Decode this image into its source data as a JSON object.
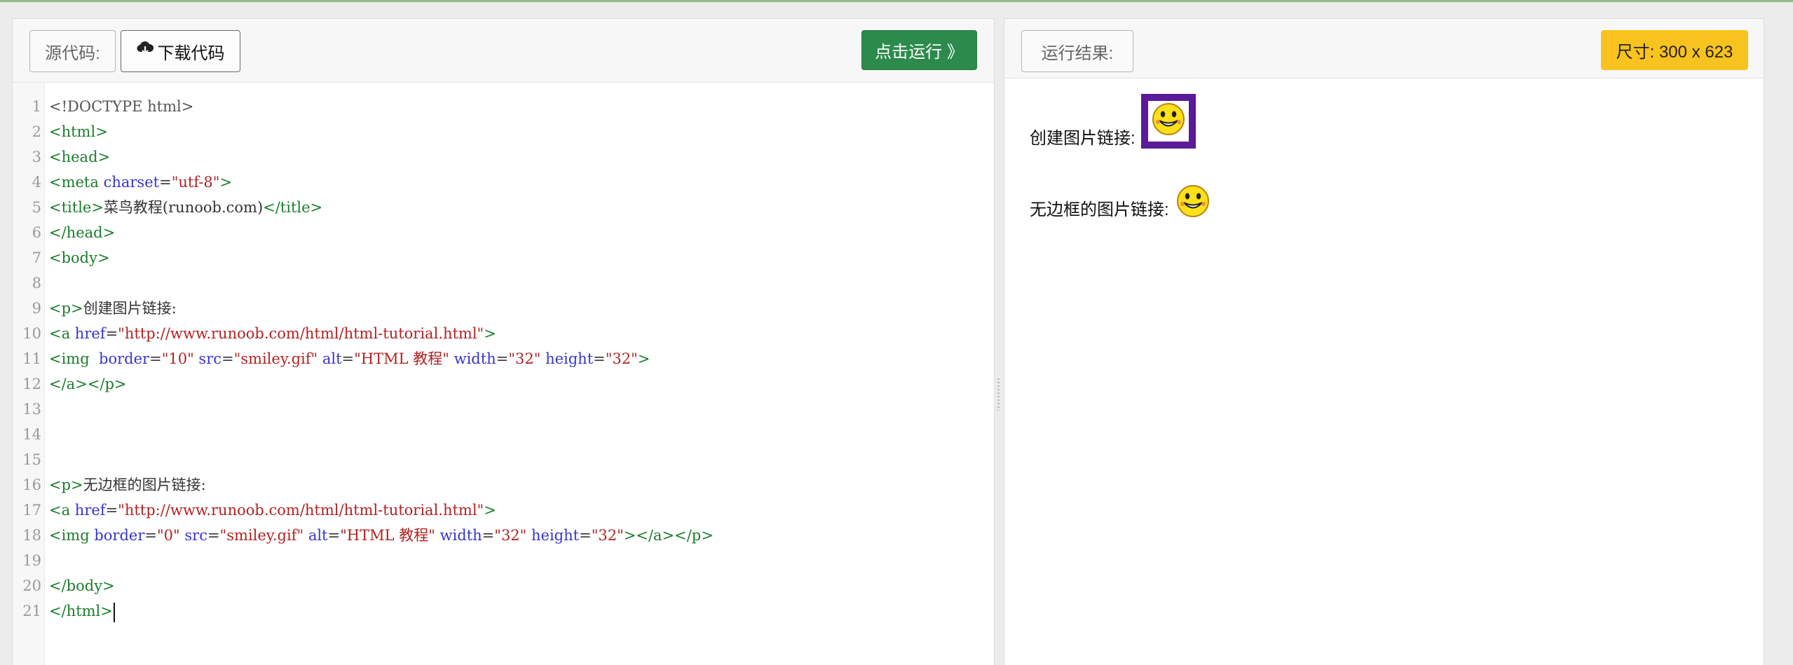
{
  "editor_toolbar": {
    "source_label": "源代码:",
    "download_label": "下载代码",
    "run_label": "点击运行 》"
  },
  "code": {
    "lines": [
      {
        "n": "1",
        "parts": [
          [
            "d",
            "<!DOCTYPE html>"
          ]
        ]
      },
      {
        "n": "2",
        "parts": [
          [
            "t",
            "<html>"
          ]
        ]
      },
      {
        "n": "3",
        "parts": [
          [
            "t",
            "<head>"
          ]
        ]
      },
      {
        "n": "4",
        "parts": [
          [
            "t",
            "<meta "
          ],
          [
            "a",
            "charset"
          ],
          [
            "p",
            "="
          ],
          [
            "s",
            "\"utf-8\""
          ],
          [
            "t",
            ">"
          ]
        ]
      },
      {
        "n": "5",
        "parts": [
          [
            "t",
            "<title>"
          ],
          [
            "p",
            "菜鸟教程(runoob.com)"
          ],
          [
            "t",
            "</title>"
          ]
        ]
      },
      {
        "n": "6",
        "parts": [
          [
            "t",
            "</head>"
          ]
        ]
      },
      {
        "n": "7",
        "parts": [
          [
            "t",
            "<body>"
          ]
        ]
      },
      {
        "n": "8",
        "parts": []
      },
      {
        "n": "9",
        "parts": [
          [
            "t",
            "<p>"
          ],
          [
            "p",
            "创建图片链接:"
          ]
        ]
      },
      {
        "n": "10",
        "parts": [
          [
            "t",
            "<a "
          ],
          [
            "a",
            "href"
          ],
          [
            "p",
            "="
          ],
          [
            "s",
            "\"http://www.runoob.com/html/html-tutorial.html\""
          ],
          [
            "t",
            ">"
          ]
        ]
      },
      {
        "n": "11",
        "parts": [
          [
            "t",
            "<img  "
          ],
          [
            "a",
            "border"
          ],
          [
            "p",
            "="
          ],
          [
            "s",
            "\"10\""
          ],
          [
            "p",
            " "
          ],
          [
            "a",
            "src"
          ],
          [
            "p",
            "="
          ],
          [
            "s",
            "\"smiley.gif\""
          ],
          [
            "p",
            " "
          ],
          [
            "a",
            "alt"
          ],
          [
            "p",
            "="
          ],
          [
            "s",
            "\"HTML 教程\""
          ],
          [
            "p",
            " "
          ],
          [
            "a",
            "width"
          ],
          [
            "p",
            "="
          ],
          [
            "s",
            "\"32\""
          ],
          [
            "p",
            " "
          ],
          [
            "a",
            "height"
          ],
          [
            "p",
            "="
          ],
          [
            "s",
            "\"32\""
          ],
          [
            "t",
            ">"
          ]
        ]
      },
      {
        "n": "12",
        "parts": [
          [
            "t",
            "</a></p>"
          ]
        ]
      },
      {
        "n": "13",
        "parts": []
      },
      {
        "n": "14",
        "parts": []
      },
      {
        "n": "15",
        "parts": []
      },
      {
        "n": "16",
        "parts": [
          [
            "t",
            "<p>"
          ],
          [
            "p",
            "无边框的图片链接:"
          ]
        ]
      },
      {
        "n": "17",
        "parts": [
          [
            "t",
            "<a "
          ],
          [
            "a",
            "href"
          ],
          [
            "p",
            "="
          ],
          [
            "s",
            "\"http://www.runoob.com/html/html-tutorial.html\""
          ],
          [
            "t",
            ">"
          ]
        ]
      },
      {
        "n": "18",
        "parts": [
          [
            "t",
            "<img "
          ],
          [
            "a",
            "border"
          ],
          [
            "p",
            "="
          ],
          [
            "s",
            "\"0\""
          ],
          [
            "p",
            " "
          ],
          [
            "a",
            "src"
          ],
          [
            "p",
            "="
          ],
          [
            "s",
            "\"smiley.gif\""
          ],
          [
            "p",
            " "
          ],
          [
            "a",
            "alt"
          ],
          [
            "p",
            "="
          ],
          [
            "s",
            "\"HTML 教程\""
          ],
          [
            "p",
            " "
          ],
          [
            "a",
            "width"
          ],
          [
            "p",
            "="
          ],
          [
            "s",
            "\"32\""
          ],
          [
            "p",
            " "
          ],
          [
            "a",
            "height"
          ],
          [
            "p",
            "="
          ],
          [
            "s",
            "\"32\""
          ],
          [
            "t",
            "></a></p>"
          ]
        ]
      },
      {
        "n": "19",
        "parts": []
      },
      {
        "n": "20",
        "parts": [
          [
            "t",
            "</body>"
          ]
        ]
      },
      {
        "n": "21",
        "parts": [
          [
            "t",
            "</html>"
          ]
        ]
      }
    ]
  },
  "result_toolbar": {
    "result_label": "运行结果:",
    "size_label": "尺寸: 300 x 623"
  },
  "result": {
    "row1_label": "创建图片链接:",
    "row2_label": "无边框的图片链接:",
    "image_icon": "smiley-icon",
    "border_color": "#5a1a99"
  },
  "colors": {
    "run_button": "#2b8a4c",
    "size_badge": "#f8c31e",
    "tag": "#1a7d2a",
    "attribute": "#3535cc",
    "string": "#b22222"
  }
}
